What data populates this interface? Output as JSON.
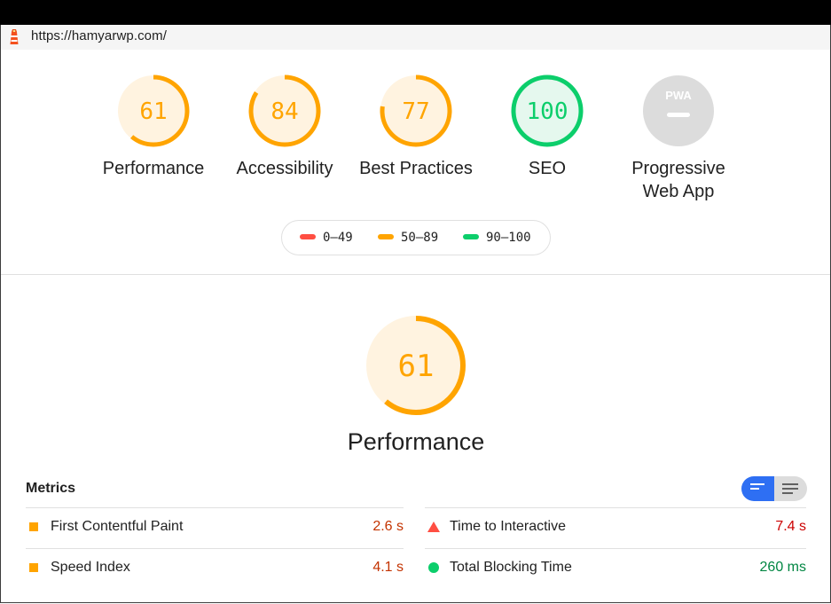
{
  "page": {
    "url": "https://hamyarwp.com/"
  },
  "icons": {
    "lighthouse": "lighthouse-icon",
    "pwa": "pwa-icon",
    "metric_average": "orange-square-icon",
    "metric_fail": "red-triangle-icon",
    "metric_pass": "green-circle-icon"
  },
  "colors": {
    "average": "#ffa400",
    "average_bg": "#fff3e0",
    "pass": "#0cce6b",
    "pass_bg": "#e5f8ee",
    "fail": "#ff4e42",
    "pass_text": "#018642",
    "average_text": "#c33300",
    "fail_text": "#cc0000",
    "na": "#dcdcdc",
    "accent": "#2e6ff3"
  },
  "gauges": [
    {
      "score": "61",
      "label": "Performance",
      "value": 0.61,
      "rating": "average"
    },
    {
      "score": "84",
      "label": "Accessibility",
      "value": 0.84,
      "rating": "average"
    },
    {
      "score": "77",
      "label": "Best Practices",
      "value": 0.77,
      "rating": "average"
    },
    {
      "score": "100",
      "label": "SEO",
      "value": 1.0,
      "rating": "pass"
    },
    {
      "label_line1": "Progressive",
      "label_line2": "Web App",
      "pwa_text": "PWA"
    }
  ],
  "legend": [
    {
      "range": "0–49",
      "rating": "fail"
    },
    {
      "range": "50–89",
      "rating": "average"
    },
    {
      "range": "90–100",
      "rating": "pass"
    }
  ],
  "performance": {
    "score": "61",
    "label": "Performance",
    "value": 0.61
  },
  "metrics": {
    "title": "Metrics",
    "items": [
      {
        "name": "First Contentful Paint",
        "value": "2.6 s",
        "rating": "average"
      },
      {
        "name": "Time to Interactive",
        "value": "7.4 s",
        "rating": "fail"
      },
      {
        "name": "Speed Index",
        "value": "4.1 s",
        "rating": "average"
      },
      {
        "name": "Total Blocking Time",
        "value": "260 ms",
        "rating": "pass"
      }
    ]
  }
}
